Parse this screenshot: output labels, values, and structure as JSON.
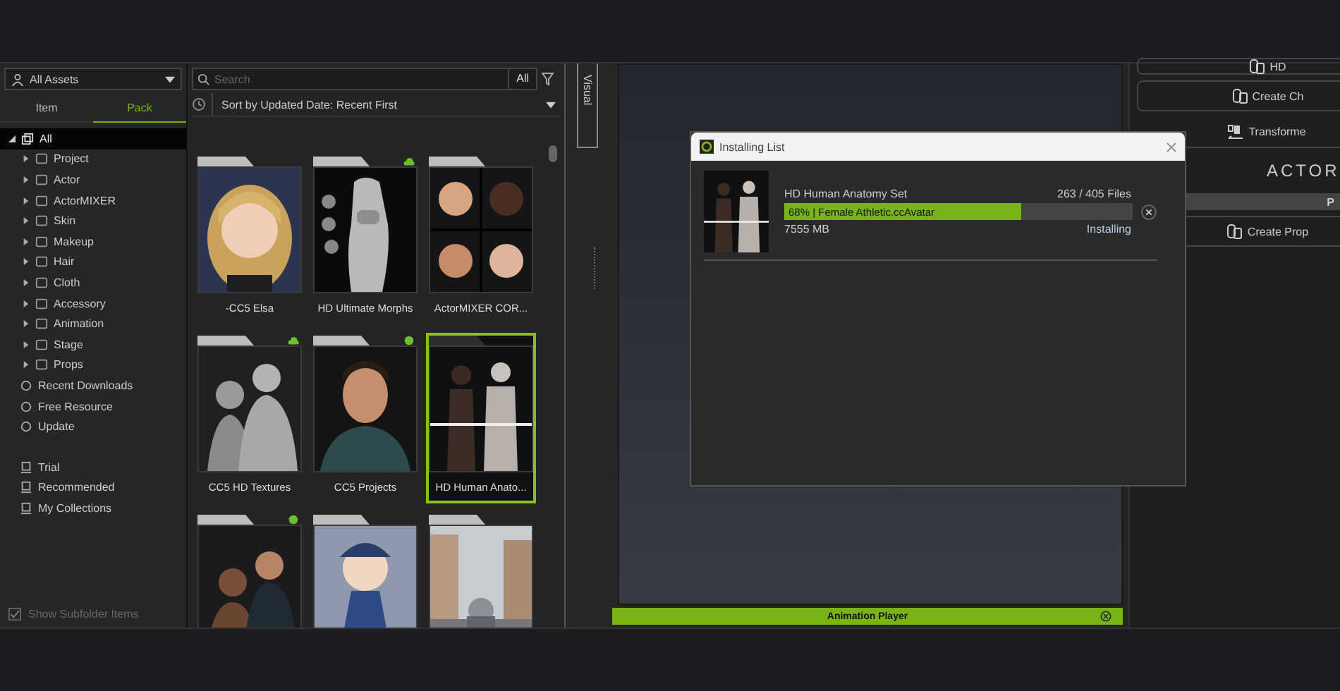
{
  "asset_panel": {
    "source_dropdown": "All Assets",
    "tabs": [
      {
        "label": "Item",
        "selected": false
      },
      {
        "label": "Pack",
        "selected": true
      }
    ],
    "tree": [
      {
        "label": "All",
        "selected": true,
        "expanded": true,
        "children": [
          {
            "label": "Project",
            "selected": false,
            "expanded": false
          },
          {
            "label": "Actor",
            "selected": false,
            "expanded": false
          },
          {
            "label": "ActorMIXER",
            "selected": false,
            "expanded": false
          },
          {
            "label": "Skin",
            "selected": false,
            "expanded": false
          },
          {
            "label": "Makeup",
            "selected": false,
            "expanded": false
          },
          {
            "label": "Hair",
            "selected": false,
            "expanded": false
          },
          {
            "label": "Cloth",
            "selected": false,
            "expanded": false
          },
          {
            "label": "Accessory",
            "selected": false,
            "expanded": false
          },
          {
            "label": "Animation",
            "selected": false,
            "expanded": false
          },
          {
            "label": "Stage",
            "selected": false,
            "expanded": false
          },
          {
            "label": "Props",
            "selected": false,
            "expanded": false
          }
        ]
      }
    ],
    "shortcuts": [
      {
        "label": "Recent Downloads"
      },
      {
        "label": "Free Resource"
      },
      {
        "label": "Update"
      }
    ],
    "store_links": [
      {
        "label": "Trial"
      },
      {
        "label": "Recommended"
      },
      {
        "label": "My Collections"
      }
    ],
    "show_subfolder_items": {
      "label": "Show Subfolder Items",
      "checked": true
    }
  },
  "library": {
    "search": {
      "placeholder": "Search"
    },
    "scope": "All",
    "sort": "Sort by Updated Date: Recent First",
    "cards": [
      {
        "label": "-CC5 Elsa",
        "selected": false,
        "cloud_badge": false,
        "dot_badge": false
      },
      {
        "label": "HD Ultimate Morphs",
        "selected": false,
        "cloud_badge": true,
        "dot_badge": false
      },
      {
        "label": "ActorMIXER COR...",
        "selected": false,
        "cloud_badge": false,
        "dot_badge": false
      },
      {
        "label": "CC5 HD Textures",
        "selected": false,
        "cloud_badge": true,
        "dot_badge": false
      },
      {
        "label": "CC5 Projects",
        "selected": false,
        "cloud_badge": false,
        "dot_badge": true
      },
      {
        "label": "HD Human Anato...",
        "selected": true,
        "cloud_badge": false,
        "dot_badge": false
      },
      {
        "selected": false,
        "cloud_badge": false,
        "dot_badge": true
      },
      {
        "selected": false,
        "cloud_badge": false,
        "dot_badge": false
      },
      {
        "selected": false,
        "cloud_badge": false,
        "dot_badge": false
      }
    ]
  },
  "visual_tab": "Visual",
  "installing_list": {
    "title": "Installing List",
    "items": [
      {
        "name": "HD Human Anatomy Set",
        "files": "263 / 405 Files",
        "level": 0.68,
        "progress_text": "68% | Female Athletic.ccAvatar",
        "size": "7555 MB",
        "status": "Installing"
      }
    ]
  },
  "right_panel": [
    {
      "kind": "button",
      "label": "HD"
    },
    {
      "kind": "button",
      "label": "Create Ch"
    },
    {
      "kind": "plain",
      "label": "Transforme"
    },
    {
      "kind": "logo",
      "label": "ACTOR"
    },
    {
      "kind": "header",
      "label": "P"
    },
    {
      "kind": "button",
      "label": "Create Prop"
    }
  ],
  "animation_player": {
    "title": "Animation Player"
  }
}
